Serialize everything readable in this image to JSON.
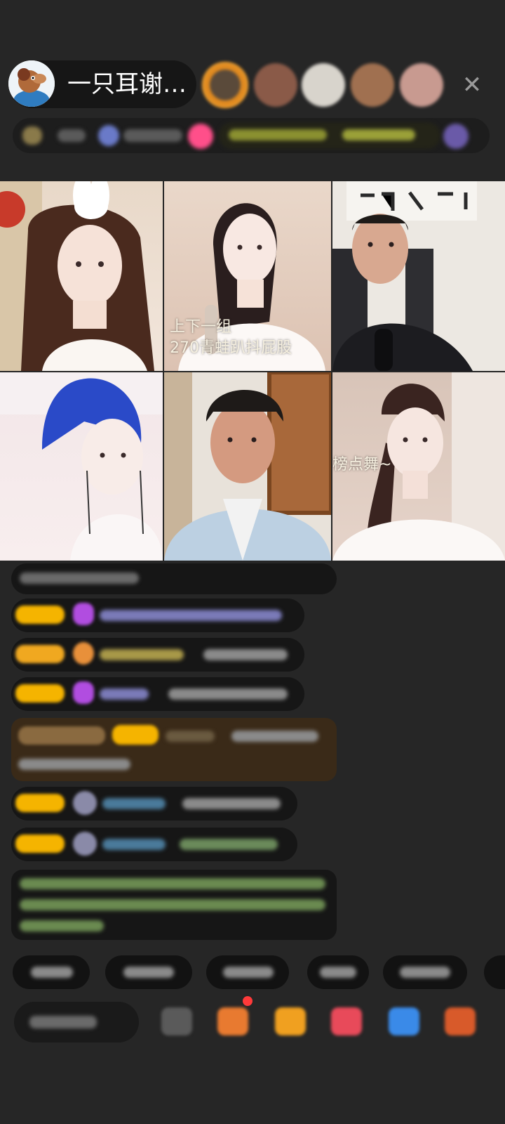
{
  "header": {
    "host_name": "一只耳谢…",
    "close_icon": "close-icon"
  },
  "video_tiles": [
    {
      "name": "tile-1",
      "caption": ""
    },
    {
      "name": "tile-2",
      "caption_line1": "上下一组",
      "caption_line2": "270青蛙趴抖屁股"
    },
    {
      "name": "tile-3",
      "caption": ""
    },
    {
      "name": "tile-4",
      "caption": ""
    },
    {
      "name": "tile-5",
      "caption": ""
    },
    {
      "name": "tile-6",
      "caption": "榜点舞~"
    }
  ],
  "colors": {
    "background": "#262626",
    "level_badge": "#f5b400",
    "accent_pink": "#ff4f8a",
    "purple_gem": "#b14de0"
  }
}
